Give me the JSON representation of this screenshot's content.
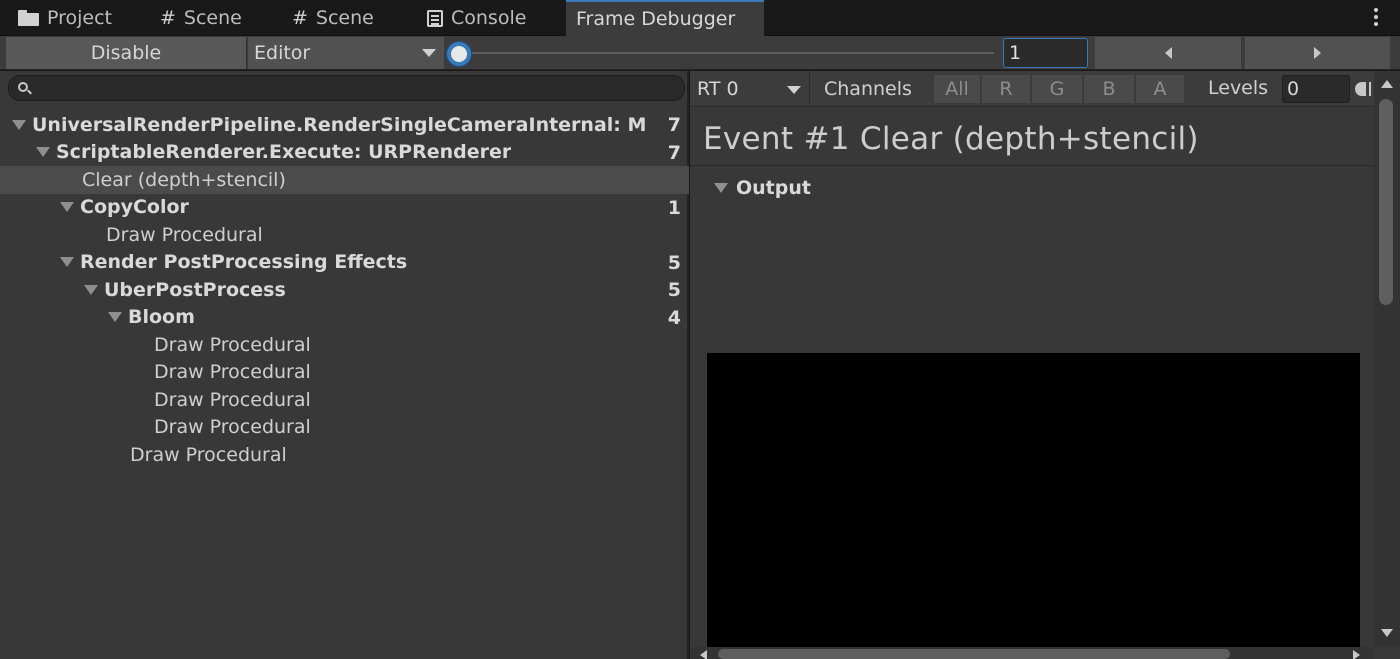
{
  "tabs": [
    {
      "label": "Project",
      "icon": "folder-icon"
    },
    {
      "label": "Scene",
      "icon": "grid-icon"
    },
    {
      "label": "Scene",
      "icon": "grid-icon"
    },
    {
      "label": "Console",
      "icon": "console-icon"
    },
    {
      "label": "Frame Debugger",
      "icon": null,
      "active": true
    }
  ],
  "toolbar": {
    "disable_label": "Disable",
    "target_dropdown": "Editor",
    "event_index": "1",
    "slider_fraction": 0.0
  },
  "search": {
    "placeholder": ""
  },
  "tree": [
    {
      "label": "UniversalRenderPipeline.RenderSingleCameraInternal: M",
      "count": "7",
      "bold": true,
      "fold": true
    },
    {
      "label": "ScriptableRenderer.Execute: URPRenderer",
      "count": "7",
      "bold": true,
      "fold": true
    },
    {
      "label": "Clear (depth+stencil)",
      "count": "",
      "bold": false,
      "fold": false,
      "selected": true
    },
    {
      "label": "CopyColor",
      "count": "1",
      "bold": true,
      "fold": true
    },
    {
      "label": "Draw Procedural",
      "count": "",
      "bold": false,
      "fold": false
    },
    {
      "label": "Render PostProcessing Effects",
      "count": "5",
      "bold": true,
      "fold": true
    },
    {
      "label": "UberPostProcess",
      "count": "5",
      "bold": true,
      "fold": true
    },
    {
      "label": "Bloom",
      "count": "4",
      "bold": true,
      "fold": true
    },
    {
      "label": "Draw Procedural",
      "count": "",
      "bold": false,
      "fold": false
    },
    {
      "label": "Draw Procedural",
      "count": "",
      "bold": false,
      "fold": false
    },
    {
      "label": "Draw Procedural",
      "count": "",
      "bold": false,
      "fold": false
    },
    {
      "label": "Draw Procedural",
      "count": "",
      "bold": false,
      "fold": false
    },
    {
      "label": "Draw Procedural",
      "count": "",
      "bold": false,
      "fold": false
    }
  ],
  "details": {
    "rt_dropdown": "RT 0",
    "channels_label": "Channels",
    "channels": [
      "All",
      "R",
      "G",
      "B",
      "A"
    ],
    "levels_label": "Levels",
    "levels_value": "0",
    "event_title": "Event #1 Clear (depth+stencil)",
    "output_label": "Output"
  },
  "colors": {
    "accent": "#3a79bb",
    "panel": "#383838",
    "preview": "#000000"
  }
}
